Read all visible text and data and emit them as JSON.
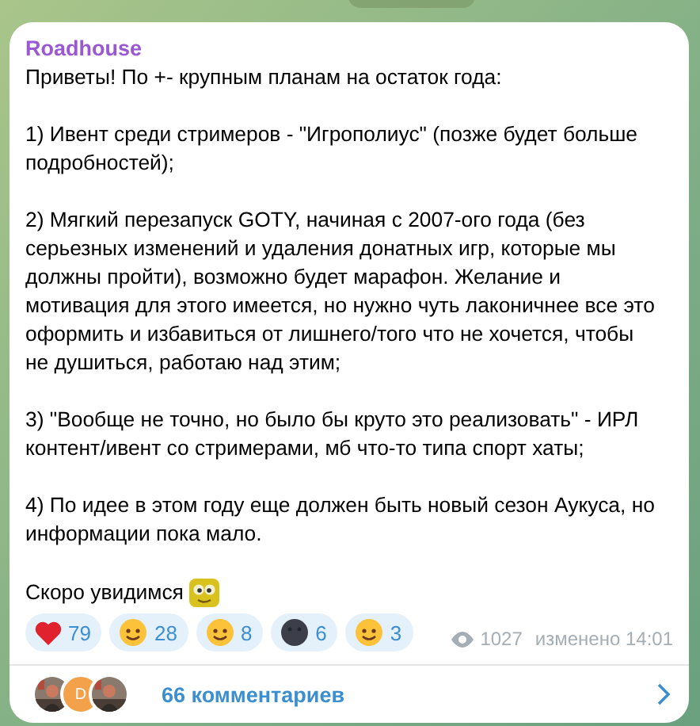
{
  "message": {
    "author": "Roadhouse",
    "paragraphs": [
      "Приветы! По +- крупным планам на остаток года:",
      "1) Ивент среди стримеров - \"Игрополиус\" (позже будет больше подробностей);",
      "2) Мягкий перезапуск GOTY, начиная с 2007-ого года (без серьезных изменений и удаления донатных игр, которые мы должны пройти), возможно будет марафон. Желание и мотивация для этого имеется, но нужно чуть лаконичнее все это оформить и избавиться от лишнего/того что не хочется, чтобы не душиться, работаю над этим;",
      "3) \"Вообще не точно, но было бы круто это реализовать\" - ИРЛ контент/ивент со стримерами, мб что-то типа спорт хаты;",
      "4) По идее в этом году еще должен быть новый сезон Аукуса, но информации пока мало.",
      "Скоро увидимся"
    ],
    "reactions": [
      {
        "kind": "heart",
        "count": "79"
      },
      {
        "kind": "face",
        "count": "28"
      },
      {
        "kind": "face",
        "count": "8"
      },
      {
        "kind": "moon",
        "count": "6"
      },
      {
        "kind": "face",
        "count": "3"
      }
    ],
    "views": "1027",
    "edited": "изменено 14:01",
    "comments": {
      "avatars": [
        {
          "kind": "picture"
        },
        {
          "kind": "letter",
          "letter": "D"
        },
        {
          "kind": "picture"
        }
      ],
      "label": "66 комментариев"
    }
  }
}
